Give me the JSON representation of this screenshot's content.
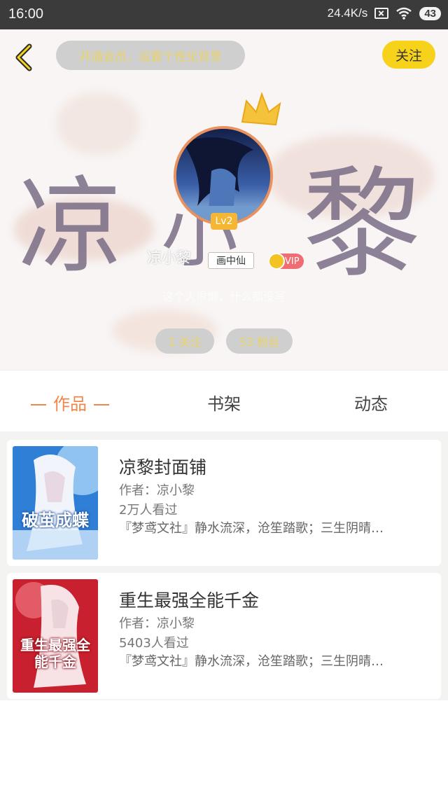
{
  "status_bar": {
    "time": "16:00",
    "network_speed": "24.4K/s",
    "battery": "43"
  },
  "header": {
    "status_prompt": "开通会员，设置个性化背景",
    "follow_label": "关注"
  },
  "profile": {
    "banner_calligraphy": [
      "凉",
      "小",
      "黎"
    ],
    "level": "Lv2",
    "username": "凉小黎",
    "title_badge": "画中仙",
    "vip_label": "VIP",
    "bio": "这个人很懒，什么都没写",
    "following": "1 关注",
    "followers": "53 粉丝"
  },
  "tabs": [
    {
      "label": "作品",
      "active": true
    },
    {
      "label": "书架",
      "active": false
    },
    {
      "label": "动态",
      "active": false
    }
  ],
  "works": [
    {
      "title": "凉黎封面铺",
      "author": "作者：凉小黎",
      "views": "2万人看过",
      "description": "『梦鸢文社』静水流深，沧笙踏歌；三生阴晴…",
      "cover_text": "破茧成蝶",
      "cover_colors": [
        "#2f7fd6",
        "#a9d4f5",
        "#f1f4fb"
      ]
    },
    {
      "title": "重生最强全能千金",
      "author": "作者：凉小黎",
      "views": "5403人看过",
      "description": "『梦鸢文社』静水流深，沧笙踏歌；三生阴晴…",
      "cover_text": "重生最强全能千金",
      "cover_colors": [
        "#c8202e",
        "#e86a76",
        "#f7e3e6"
      ]
    }
  ],
  "colors": {
    "accent_orange": "#f0874a",
    "follow_yellow": "#f7d21a",
    "vip_pink": "#f06e73"
  },
  "icons": [
    "back-chevron-icon",
    "sim-card-icon",
    "wifi-icon",
    "crown-icon",
    "vip-coin-icon"
  ]
}
